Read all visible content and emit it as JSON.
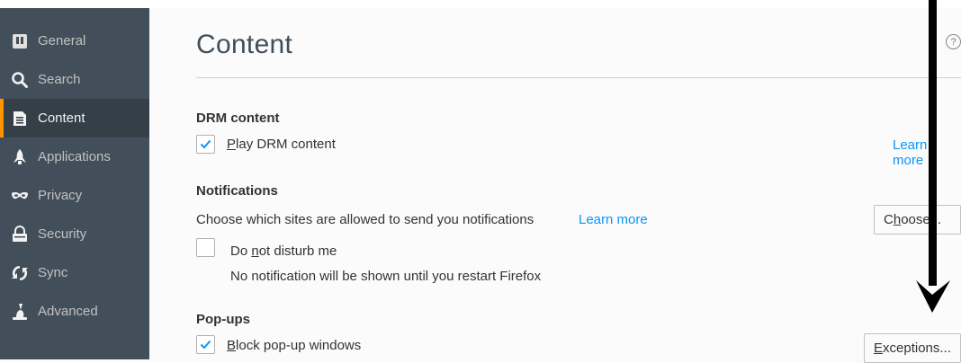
{
  "sidebar": {
    "items": [
      {
        "label": "General",
        "icon": "general-icon"
      },
      {
        "label": "Search",
        "icon": "search-icon"
      },
      {
        "label": "Content",
        "icon": "content-icon",
        "active": true
      },
      {
        "label": "Applications",
        "icon": "applications-icon"
      },
      {
        "label": "Privacy",
        "icon": "privacy-icon"
      },
      {
        "label": "Security",
        "icon": "security-icon"
      },
      {
        "label": "Sync",
        "icon": "sync-icon"
      },
      {
        "label": "Advanced",
        "icon": "advanced-icon"
      }
    ]
  },
  "main": {
    "title": "Content",
    "help_icon": "?",
    "drm": {
      "title": "DRM content",
      "checkbox_label_u": "P",
      "checkbox_label_rest": "lay DRM content",
      "checked": true,
      "learn_more": "Learn more"
    },
    "notifications": {
      "title": "Notifications",
      "description": "Choose which sites are allowed to send you notifications",
      "learn_more": "Learn more",
      "choose_button_pre": "C",
      "choose_button_u": "h",
      "choose_button_rest": "oose...",
      "dnd_pre": "Do ",
      "dnd_u": "n",
      "dnd_rest": "ot disturb me",
      "dnd_checked": false,
      "dnd_note": "No notification will be shown until you restart Firefox"
    },
    "popups": {
      "title": "Pop-ups",
      "block_u": "B",
      "block_rest": "lock pop-up windows",
      "checked": true,
      "exceptions_u": "E",
      "exceptions_rest": "xceptions..."
    }
  },
  "colors": {
    "sidebar_bg": "#424f5a",
    "sidebar_active_bg": "#343f48",
    "active_indicator": "#ff9500",
    "link": "#0996f8",
    "checkmark": "#0996f8"
  }
}
